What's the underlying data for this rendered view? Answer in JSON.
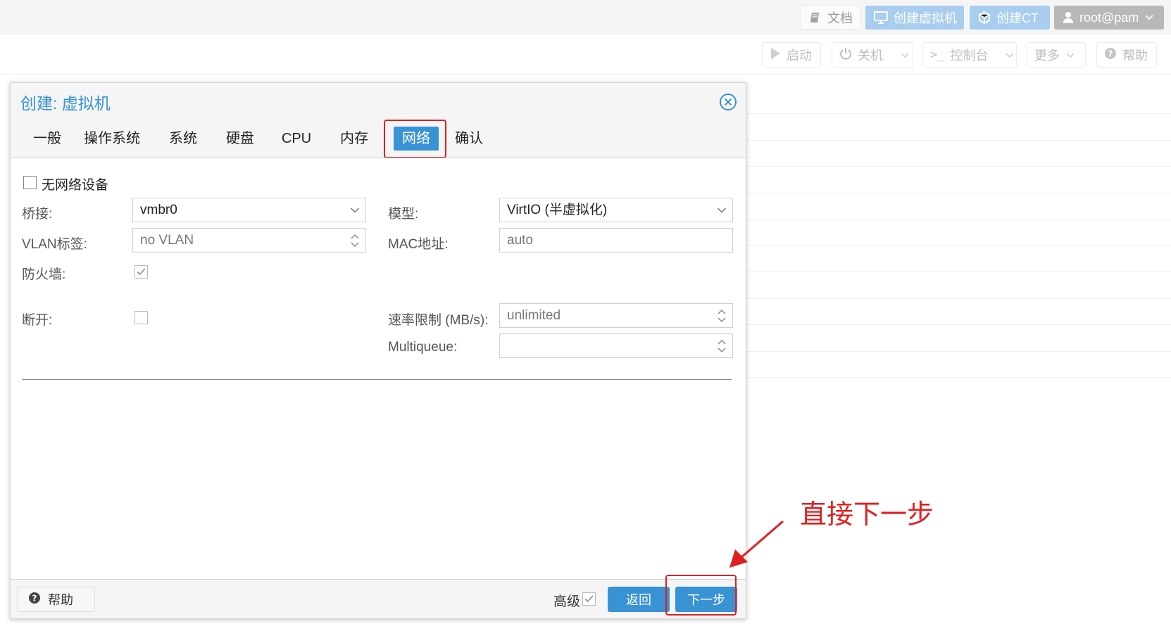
{
  "topbar": {
    "docs": "文档",
    "create_vm": "创建虚拟机",
    "create_ct": "创建CT",
    "user": "root@pam"
  },
  "toolbar": {
    "start": "启动",
    "shutdown": "关机",
    "console": "控制台",
    "more": "更多",
    "help": "帮助"
  },
  "dialog": {
    "title": "创建: 虚拟机",
    "tabs": [
      "一般",
      "操作系统",
      "系统",
      "硬盘",
      "CPU",
      "内存",
      "网络",
      "确认"
    ],
    "active_tab": "网络",
    "no_network_label": "无网络设备",
    "form": {
      "bridge_label": "桥接:",
      "bridge_value": "vmbr0",
      "model_label": "模型:",
      "model_value": "VirtIO (半虚拟化)",
      "vlan_label": "VLAN标签:",
      "vlan_value": "no VLAN",
      "mac_label": "MAC地址:",
      "mac_value": "auto",
      "firewall_label": "防火墙:",
      "firewall_checked": true,
      "disconnect_label": "断开:",
      "disconnect_checked": false,
      "rate_label": "速率限制 (MB/s):",
      "rate_value": "unlimited",
      "multiqueue_label": "Multiqueue:",
      "multiqueue_value": ""
    },
    "footer": {
      "help": "帮助",
      "advanced": "高级",
      "advanced_checked": true,
      "back": "返回",
      "next": "下一步"
    }
  },
  "annotation": {
    "text": "直接下一步",
    "color": "#e02020"
  },
  "colors": {
    "accent": "#3892d4",
    "highlight": "#e02020"
  }
}
